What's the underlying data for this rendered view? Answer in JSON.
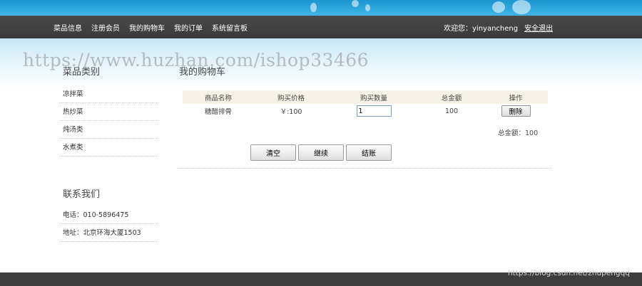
{
  "nav": {
    "links": [
      "菜品信息",
      "注册会员",
      "我的购物车",
      "我的订单",
      "系统留言板"
    ],
    "welcome": "欢迎您：yinyancheng",
    "logout": "安全退出"
  },
  "watermark": {
    "top": "https://www.huzhan.com/ishop33466",
    "bottom": "https://blog.csdn.net/zhupengqq"
  },
  "sidebar": {
    "categories_title": "菜品类别",
    "categories": [
      "凉拌菜",
      "热炒菜",
      "炖汤类",
      "水煮类"
    ],
    "contact_title": "联系我们",
    "contact": {
      "phone": "电话：010-5896475",
      "address": "地址：北京环海大厦1503"
    }
  },
  "cart": {
    "title": "我的购物车",
    "headers": [
      "商品名称",
      "购买价格",
      "购买数量",
      "总金额",
      "操作"
    ],
    "rows": [
      {
        "name": "糖醋排骨",
        "price": "￥:100",
        "quantity": "1",
        "total": "100",
        "action": "删除"
      }
    ],
    "grand_total": "总金额：100",
    "buttons": {
      "clear": "清空",
      "continue": "继续",
      "checkout": "结账"
    }
  },
  "colors": {
    "top_banner": "#2ea8dd",
    "nav_bar": "#3f3f3f",
    "table_header": "#f7f2e8",
    "footer": "#3d3d3d"
  }
}
